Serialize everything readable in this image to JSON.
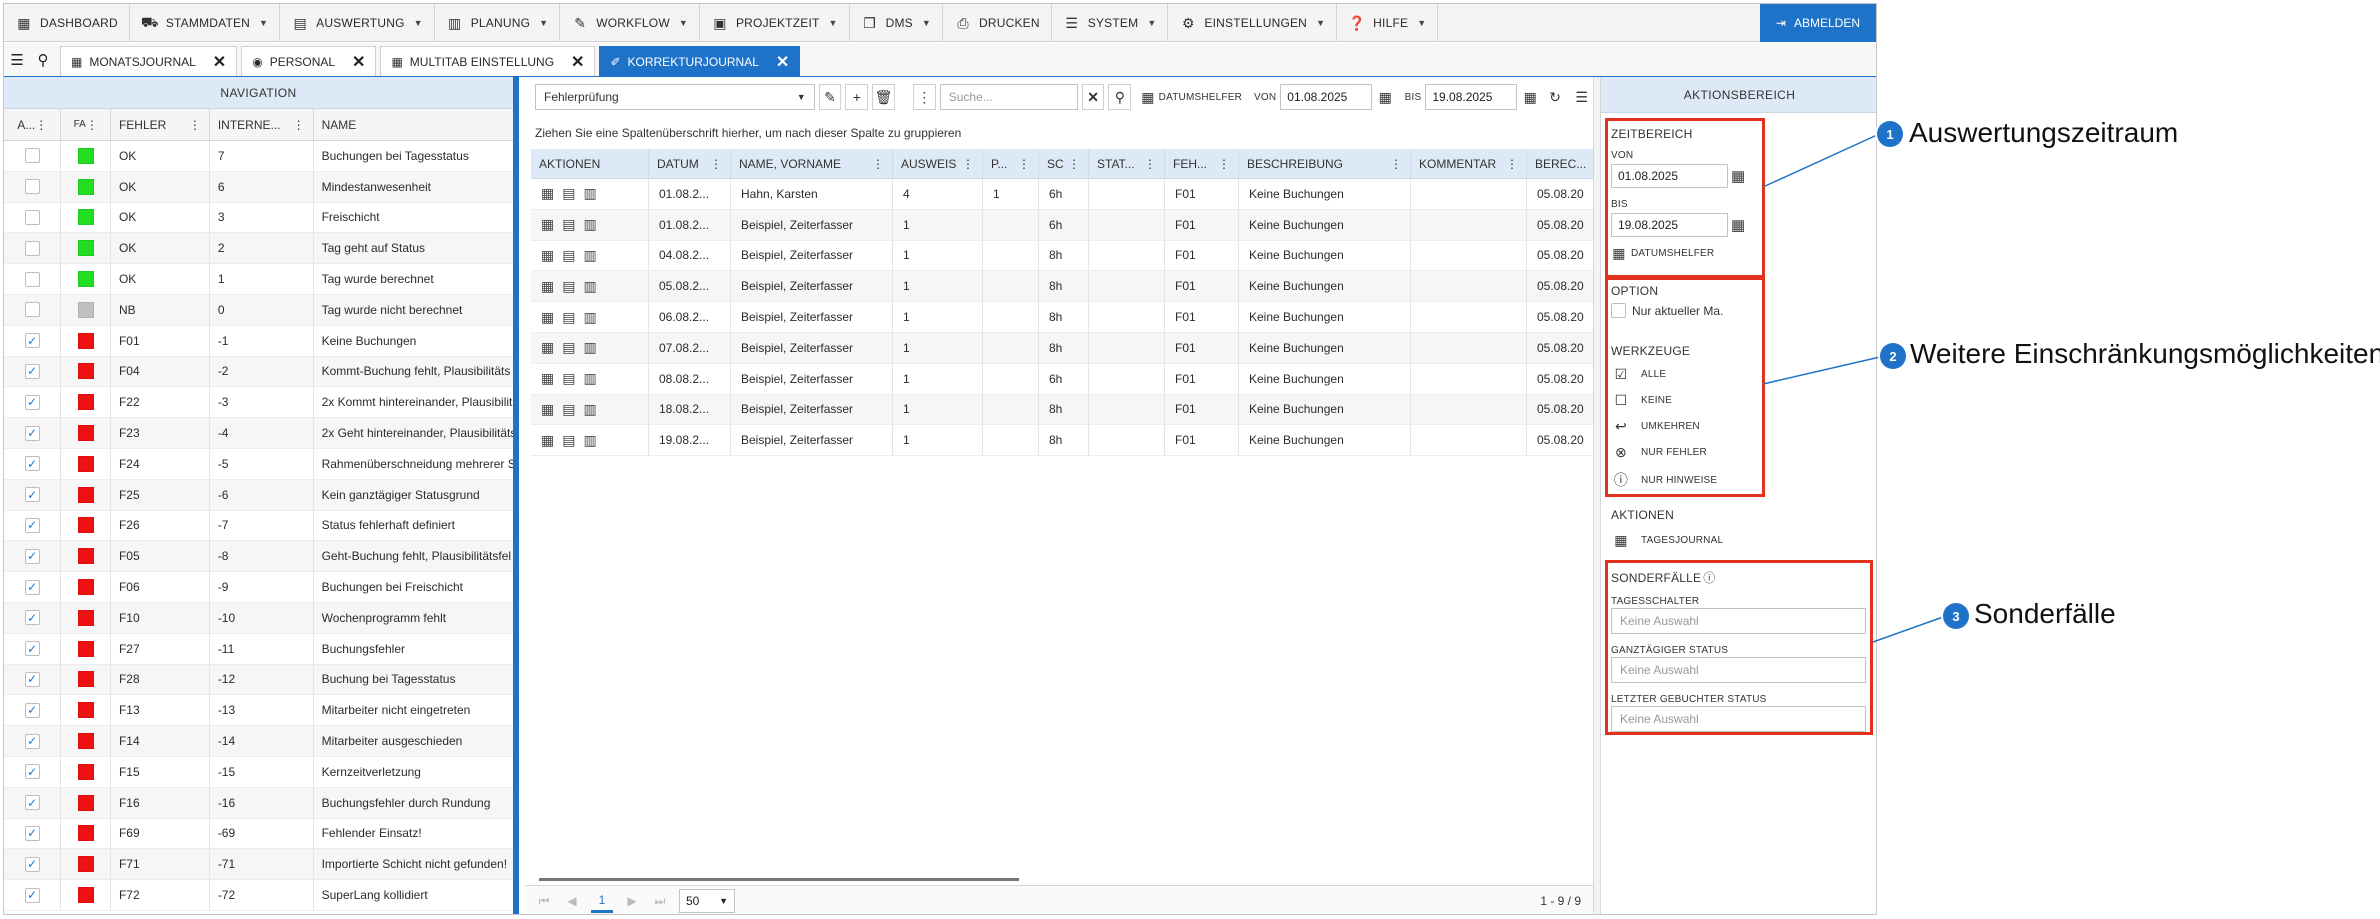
{
  "menu": {
    "items": [
      {
        "label": "DASHBOARD",
        "icon": "dashboard-icon",
        "caret": false
      },
      {
        "label": "STAMMDATEN",
        "icon": "cars-icon",
        "caret": true
      },
      {
        "label": "AUSWERTUNG",
        "icon": "folder-icon",
        "caret": true
      },
      {
        "label": "PLANUNG",
        "icon": "calendar-icon",
        "caret": true
      },
      {
        "label": "WORKFLOW",
        "icon": "pen-icon",
        "caret": true
      },
      {
        "label": "PROJEKTZEIT",
        "icon": "briefcase-icon",
        "caret": true
      },
      {
        "label": "DMS",
        "icon": "copy-icon",
        "caret": true
      },
      {
        "label": "DRUCKEN",
        "icon": "print-icon",
        "caret": false
      },
      {
        "label": "SYSTEM",
        "icon": "server-icon",
        "caret": true
      },
      {
        "label": "EINSTELLUNGEN",
        "icon": "gear-icon",
        "caret": true
      },
      {
        "label": "HILFE",
        "icon": "help-icon",
        "caret": true
      }
    ],
    "logout": "ABMELDEN"
  },
  "tabs": [
    {
      "label": "MONATSJOURNAL",
      "icon": "calendar-icon",
      "active": false
    },
    {
      "label": "PERSONAL",
      "icon": "user-icon",
      "active": false
    },
    {
      "label": "MULTITAB EINSTELLUNG",
      "icon": "grid-icon",
      "active": false
    },
    {
      "label": "KORREKTURJOURNAL",
      "icon": "eraser-icon",
      "active": true
    }
  ],
  "navigation": {
    "title": "NAVIGATION",
    "columns": [
      "A...",
      "FA",
      "FEHLER",
      "INTERNE...",
      "NAME"
    ],
    "rows": [
      {
        "checked": false,
        "color": "#22dd22",
        "fehler": "OK",
        "intern": "7",
        "name": "Buchungen bei Tagesstatus"
      },
      {
        "checked": false,
        "color": "#22dd22",
        "fehler": "OK",
        "intern": "6",
        "name": "Mindestanwesenheit"
      },
      {
        "checked": false,
        "color": "#22dd22",
        "fehler": "OK",
        "intern": "3",
        "name": "Freischicht"
      },
      {
        "checked": false,
        "color": "#22dd22",
        "fehler": "OK",
        "intern": "2",
        "name": "Tag geht auf Status"
      },
      {
        "checked": false,
        "color": "#22dd22",
        "fehler": "OK",
        "intern": "1",
        "name": "Tag wurde berechnet"
      },
      {
        "checked": false,
        "color": "#c0c0c0",
        "fehler": "NB",
        "intern": "0",
        "name": "Tag wurde nicht berechnet"
      },
      {
        "checked": true,
        "color": "#ee1111",
        "fehler": "F01",
        "intern": "-1",
        "name": "Keine Buchungen"
      },
      {
        "checked": true,
        "color": "#ee1111",
        "fehler": "F04",
        "intern": "-2",
        "name": "Kommt-Buchung fehlt, Plausibilitäts"
      },
      {
        "checked": true,
        "color": "#ee1111",
        "fehler": "F22",
        "intern": "-3",
        "name": "2x Kommt hintereinander, Plausibilit"
      },
      {
        "checked": true,
        "color": "#ee1111",
        "fehler": "F23",
        "intern": "-4",
        "name": "2x Geht hintereinander, Plausibilitäts"
      },
      {
        "checked": true,
        "color": "#ee1111",
        "fehler": "F24",
        "intern": "-5",
        "name": "Rahmenüberschneidung mehrerer S"
      },
      {
        "checked": true,
        "color": "#ee1111",
        "fehler": "F25",
        "intern": "-6",
        "name": "Kein ganztägiger Statusgrund"
      },
      {
        "checked": true,
        "color": "#ee1111",
        "fehler": "F26",
        "intern": "-7",
        "name": "Status fehlerhaft definiert"
      },
      {
        "checked": true,
        "color": "#ee1111",
        "fehler": "F05",
        "intern": "-8",
        "name": "Geht-Buchung fehlt, Plausibilitätsfel"
      },
      {
        "checked": true,
        "color": "#ee1111",
        "fehler": "F06",
        "intern": "-9",
        "name": "Buchungen bei Freischicht"
      },
      {
        "checked": true,
        "color": "#ee1111",
        "fehler": "F10",
        "intern": "-10",
        "name": "Wochenprogramm fehlt"
      },
      {
        "checked": true,
        "color": "#ee1111",
        "fehler": "F27",
        "intern": "-11",
        "name": "Buchungsfehler"
      },
      {
        "checked": true,
        "color": "#ee1111",
        "fehler": "F28",
        "intern": "-12",
        "name": "Buchung bei Tagesstatus"
      },
      {
        "checked": true,
        "color": "#ee1111",
        "fehler": "F13",
        "intern": "-13",
        "name": "Mitarbeiter nicht eingetreten"
      },
      {
        "checked": true,
        "color": "#ee1111",
        "fehler": "F14",
        "intern": "-14",
        "name": "Mitarbeiter ausgeschieden"
      },
      {
        "checked": true,
        "color": "#ee1111",
        "fehler": "F15",
        "intern": "-15",
        "name": "Kernzeitverletzung"
      },
      {
        "checked": true,
        "color": "#ee1111",
        "fehler": "F16",
        "intern": "-16",
        "name": "Buchungsfehler durch Rundung"
      },
      {
        "checked": true,
        "color": "#ee1111",
        "fehler": "F69",
        "intern": "-69",
        "name": "Fehlender Einsatz!"
      },
      {
        "checked": true,
        "color": "#ee1111",
        "fehler": "F71",
        "intern": "-71",
        "name": "Importierte Schicht nicht gefunden!"
      },
      {
        "checked": true,
        "color": "#ee1111",
        "fehler": "F72",
        "intern": "-72",
        "name": "SuperLang kollidiert"
      }
    ]
  },
  "main": {
    "view_select": "Fehlerprüfung",
    "search_placeholder": "Suche...",
    "datumshelfer": "DATUMSHELFER",
    "von_label": "VON",
    "von_value": "01.08.2025",
    "bis_label": "BIS",
    "bis_value": "19.08.2025",
    "group_hint": "Ziehen Sie eine Spaltenüberschrift hierher, um nach dieser Spalte zu gruppieren",
    "columns": [
      "AKTIONEN",
      "DATUM",
      "NAME, VORNAME",
      "AUSWEIS",
      "P...",
      "SC",
      "STAT...",
      "FEH...",
      "BESCHREIBUNG",
      "KOMMENTAR",
      "BEREC..."
    ],
    "rows": [
      {
        "datum": "01.08.2...",
        "name": "Hahn, Karsten",
        "ausweis": "4",
        "p": "1",
        "sc": "6h",
        "stat": "",
        "feh": "F01",
        "beschreibung": "Keine Buchungen",
        "kommentar": "",
        "berec": "05.08.20"
      },
      {
        "datum": "01.08.2...",
        "name": "Beispiel, Zeiterfasser",
        "ausweis": "1",
        "p": "",
        "sc": "6h",
        "stat": "",
        "feh": "F01",
        "beschreibung": "Keine Buchungen",
        "kommentar": "",
        "berec": "05.08.20"
      },
      {
        "datum": "04.08.2...",
        "name": "Beispiel, Zeiterfasser",
        "ausweis": "1",
        "p": "",
        "sc": "8h",
        "stat": "",
        "feh": "F01",
        "beschreibung": "Keine Buchungen",
        "kommentar": "",
        "berec": "05.08.20"
      },
      {
        "datum": "05.08.2...",
        "name": "Beispiel, Zeiterfasser",
        "ausweis": "1",
        "p": "",
        "sc": "8h",
        "stat": "",
        "feh": "F01",
        "beschreibung": "Keine Buchungen",
        "kommentar": "",
        "berec": "05.08.20"
      },
      {
        "datum": "06.08.2...",
        "name": "Beispiel, Zeiterfasser",
        "ausweis": "1",
        "p": "",
        "sc": "8h",
        "stat": "",
        "feh": "F01",
        "beschreibung": "Keine Buchungen",
        "kommentar": "",
        "berec": "05.08.20"
      },
      {
        "datum": "07.08.2...",
        "name": "Beispiel, Zeiterfasser",
        "ausweis": "1",
        "p": "",
        "sc": "8h",
        "stat": "",
        "feh": "F01",
        "beschreibung": "Keine Buchungen",
        "kommentar": "",
        "berec": "05.08.20"
      },
      {
        "datum": "08.08.2...",
        "name": "Beispiel, Zeiterfasser",
        "ausweis": "1",
        "p": "",
        "sc": "6h",
        "stat": "",
        "feh": "F01",
        "beschreibung": "Keine Buchungen",
        "kommentar": "",
        "berec": "05.08.20"
      },
      {
        "datum": "18.08.2...",
        "name": "Beispiel, Zeiterfasser",
        "ausweis": "1",
        "p": "",
        "sc": "8h",
        "stat": "",
        "feh": "F01",
        "beschreibung": "Keine Buchungen",
        "kommentar": "",
        "berec": "05.08.20"
      },
      {
        "datum": "19.08.2...",
        "name": "Beispiel, Zeiterfasser",
        "ausweis": "1",
        "p": "",
        "sc": "8h",
        "stat": "",
        "feh": "F01",
        "beschreibung": "Keine Buchungen",
        "kommentar": "",
        "berec": "05.08.20"
      }
    ],
    "pager": {
      "current": "1",
      "page_size": "50",
      "info": "1 - 9 / 9"
    }
  },
  "actions": {
    "title": "AKTIONSBEREICH",
    "zeitbereich": "ZEITBEREICH",
    "von_label": "VON",
    "von_value": "01.08.2025",
    "bis_label": "BIS",
    "bis_value": "19.08.2025",
    "datumshelfer": "DATUMSHELFER",
    "option": "OPTION",
    "nur_aktueller": "Nur aktueller Ma.",
    "werkzeuge": "WERKZEUGE",
    "tools": [
      "ALLE",
      "KEINE",
      "UMKEHREN",
      "NUR FEHLER",
      "NUR HINWEISE"
    ],
    "aktionen": "AKTIONEN",
    "tagesjournal": "TAGESJOURNAL",
    "sonderfaelle": "SONDERFÄLLE",
    "tagesschalter_label": "TAGESSCHALTER",
    "ganztaegig_label": "GANZTÄGIGER STATUS",
    "letzter_label": "LETZTER GEBUCHTER STATUS",
    "combo_placeholder": "Keine Auswahl"
  },
  "annotations": [
    {
      "number": "1",
      "text": "Auswertungszeitraum"
    },
    {
      "number": "2",
      "text": "Weitere Einschränkungsmöglichkeiten"
    },
    {
      "number": "3",
      "text": "Sonderfälle"
    }
  ],
  "colors": {
    "accent": "#1e73c8",
    "highlight": "#e0321e",
    "ok": "#22dd22",
    "error": "#ee1111",
    "neutral": "#c0c0c0"
  }
}
